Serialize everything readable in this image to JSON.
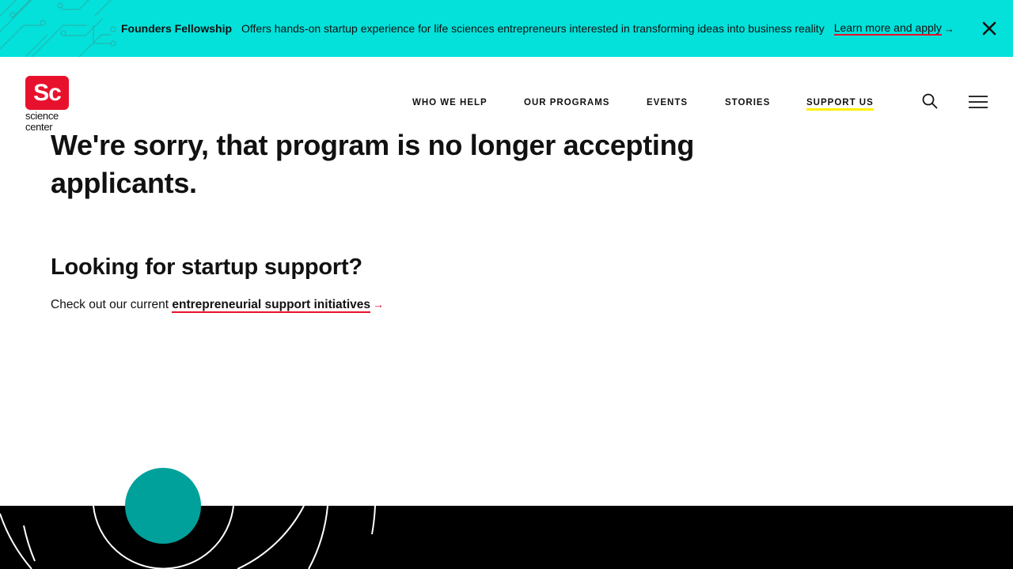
{
  "banner": {
    "title": "Founders Fellowship",
    "description": "Offers hands-on startup experience for life sciences entrepreneurs interested in transforming ideas into business reality",
    "link_text": "Learn more and apply",
    "link_arrow": "→",
    "close_icon": "close-icon",
    "background_color": "#03e1da"
  },
  "logo": {
    "mark": "Sc",
    "line1": "science",
    "line2": "center",
    "color": "#e8112d"
  },
  "nav": {
    "items": [
      {
        "label": "WHO WE HELP"
      },
      {
        "label": "OUR PROGRAMS"
      },
      {
        "label": "EVENTS"
      },
      {
        "label": "STORIES"
      },
      {
        "label": "SUPPORT US",
        "active": true
      }
    ],
    "search_icon": "search-icon",
    "menu_icon": "hamburger-menu-icon",
    "active_underline_color": "#fff200"
  },
  "main": {
    "headline": "We're sorry, that program is no longer accepting applicants.",
    "subhead": "Looking for startup support?",
    "body_prefix": "Check out our current",
    "body_link": "entrepreneurial support initiatives",
    "body_arrow": "→",
    "link_underline_color": "#e8112d"
  },
  "footer": {
    "background_color": "#000000",
    "accent_circle_color": "#00a19b"
  }
}
